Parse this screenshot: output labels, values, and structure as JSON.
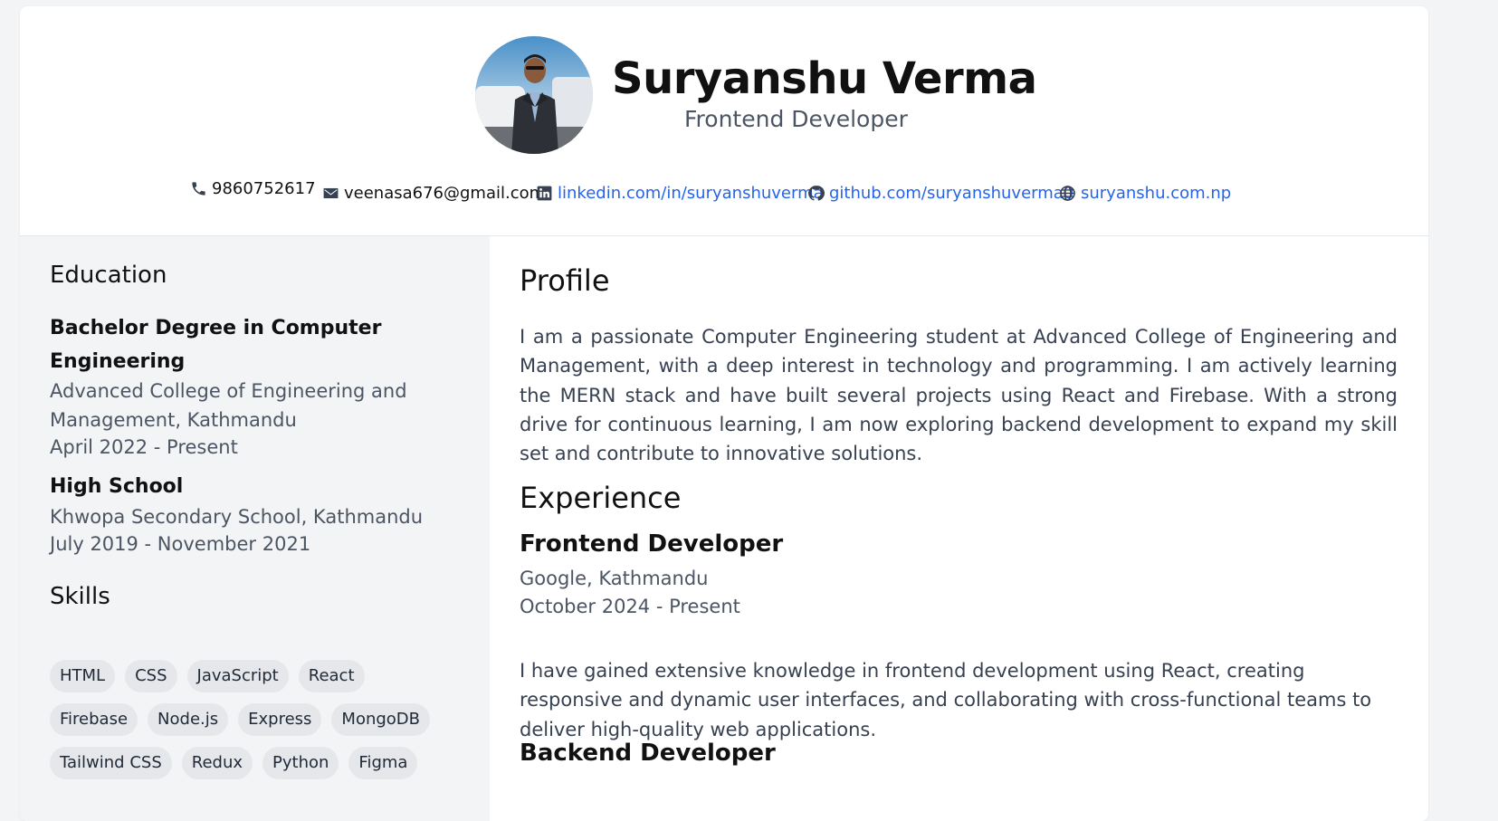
{
  "header": {
    "name": "Suryanshu Verma",
    "title": "Frontend Developer",
    "contacts": {
      "phone": "9860752617",
      "email": "veenasa676@gmail.com",
      "linkedin": "linkedin.com/in/suryanshuverma",
      "github": "github.com/suryanshuverma0",
      "website": "suryanshu.com.np"
    }
  },
  "sidebar": {
    "education_heading": "Education",
    "education": [
      {
        "degree": "Bachelor Degree in Computer Engineering",
        "school": "Advanced College of Engineering and Management, Kathmandu",
        "dates": "April 2022 - Present"
      },
      {
        "degree": "High School",
        "school": "Khwopa Secondary School, Kathmandu",
        "dates": "July 2019 - November 2021"
      }
    ],
    "skills_heading": "Skills",
    "skills": [
      "HTML",
      "CSS",
      "JavaScript",
      "React",
      "Firebase",
      "Node.js",
      "Express",
      "MongoDB",
      "Tailwind CSS",
      "Redux",
      "Python",
      "Figma"
    ]
  },
  "main": {
    "profile_heading": "Profile",
    "profile_text": "I am a passionate Computer Engineering student at Advanced College of Engineering and Management, with a deep interest in technology and programming. I am actively learning the MERN stack and have built several projects using React and Firebase. With a strong drive for continuous learning, I am now exploring backend development to expand my skill set and contribute to innovative solutions.",
    "experience_heading": "Experience",
    "jobs": [
      {
        "title": "Frontend Developer",
        "company": "Google, Kathmandu",
        "dates": "October 2024 - Present",
        "description": "I have gained extensive knowledge in frontend development using React, creating responsive and dynamic user interfaces, and collaborating with cross-functional teams to deliver high-quality web applications."
      },
      {
        "title": "Backend Developer"
      }
    ]
  },
  "colors": {
    "link": "#2563eb",
    "muted_text": "#4b5563",
    "sidebar_bg": "#f3f4f6",
    "chip_bg": "#e5e7eb"
  },
  "icons": [
    "phone-icon",
    "envelope-icon",
    "linkedin-icon",
    "github-icon",
    "globe-icon"
  ]
}
